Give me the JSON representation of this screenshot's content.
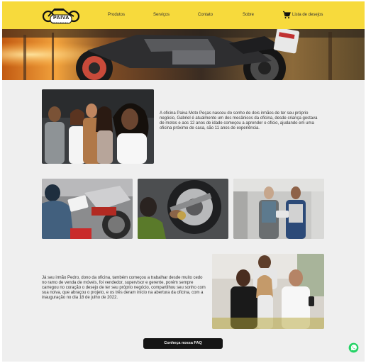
{
  "header": {
    "logo_name": "PAIVA",
    "logo_sub": "MOTO PEÇAS",
    "nav": [
      "Produtos",
      "Serviços",
      "Contato",
      "Sobre"
    ],
    "cart_label": "Lista de desejos"
  },
  "about": {
    "paragraph1": "A oficina Paiva Moto Peças nasceu do sonho de dois irmãos de ter seu próprio negócio, Gabriel é atualmente um dos mecânicos da oficina, desde criança gostava de motos e aos 12 anos de idade começou a aprender o ofício, ajudando em uma oficina próximo de casa, são 11 anos de experiência.",
    "paragraph2": "Já seu irmão Pedro, dono da oficina, também começou a trabalhar desde muito cedo no ramo de venda de móveis, foi vendedor, supervisor e gerente, porém sempre carregou no coração o desejo de ter seu próprio negócio, compartilhou seu sonho com sua noiva, que abraçou o projeto, e os três deram início na abertura da oficina, com a inauguração no dia 18 de julho de 2022."
  },
  "faq_button": "Conheça nossa FAQ",
  "icons": [
    "moto-logo-icon",
    "cart-icon",
    "whatsapp-icon"
  ],
  "colors": {
    "topbar": "#f7da3c",
    "button": "#151515",
    "whatsapp": "#25d366"
  }
}
